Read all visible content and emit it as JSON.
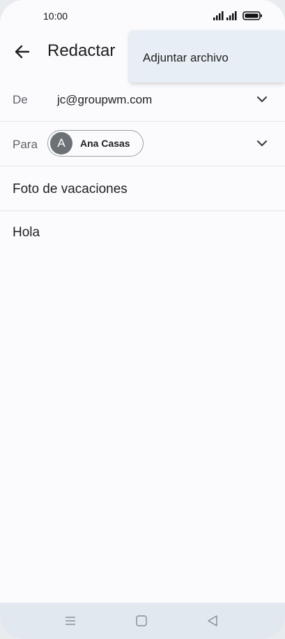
{
  "status_bar": {
    "time": "10:00",
    "icons": [
      "signal-icon",
      "signal-icon",
      "battery-icon"
    ]
  },
  "app_bar": {
    "back_icon": "arrow-left-icon",
    "title": "Redactar"
  },
  "menu": {
    "items": [
      {
        "label": "Adjuntar archivo"
      }
    ]
  },
  "compose": {
    "from": {
      "label": "De",
      "value": "jc@groupwm.com"
    },
    "to": {
      "label": "Para",
      "recipient": {
        "initial": "A",
        "name": "Ana Casas"
      }
    },
    "subject": "Foto de vacaciones",
    "body": "Hola"
  },
  "nav_bar": {
    "buttons": [
      "menu-icon",
      "home-icon",
      "back-triangle-icon"
    ]
  },
  "colors": {
    "background": "#fbfbfe",
    "menu_background": "#e8eef5",
    "nav_background": "#e2e8ef",
    "avatar": "#6b7175",
    "text": "#1f1f1f",
    "label": "#5f6368"
  }
}
